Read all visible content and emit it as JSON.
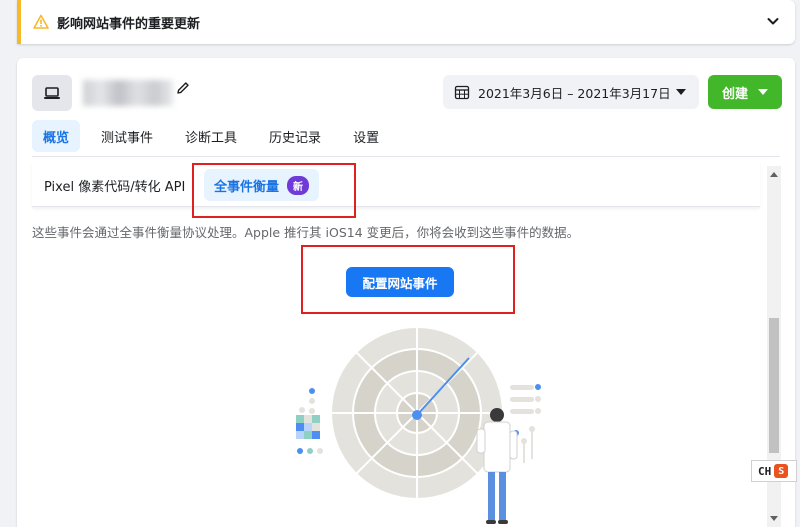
{
  "banner": {
    "title": "影响网站事件的重要更新"
  },
  "header": {
    "date_range": "2021年3月6日 – 2021年3月17日",
    "create_label": "创建"
  },
  "tabs": [
    {
      "label": "概览",
      "active": true
    },
    {
      "label": "测试事件",
      "active": false
    },
    {
      "label": "诊断工具",
      "active": false
    },
    {
      "label": "历史记录",
      "active": false
    },
    {
      "label": "设置",
      "active": false
    }
  ],
  "subtabs": {
    "pixel_label": "Pixel 像素代码/转化 API",
    "aem_label": "全事件衡量",
    "aem_badge": "新"
  },
  "main": {
    "description": "这些事件会通过全事件衡量协议处理。Apple 推行其 iOS14 变更后，你将会收到这些事件的数据。",
    "config_button": "配置网站事件"
  },
  "ime": {
    "label": "CH",
    "logo": "S"
  },
  "colors": {
    "primary": "#1877f2",
    "create_green": "#42b72a",
    "badge_purple": "#6e3ad8",
    "warning_yellow": "#f7b928",
    "annotation_red": "#e02020"
  }
}
